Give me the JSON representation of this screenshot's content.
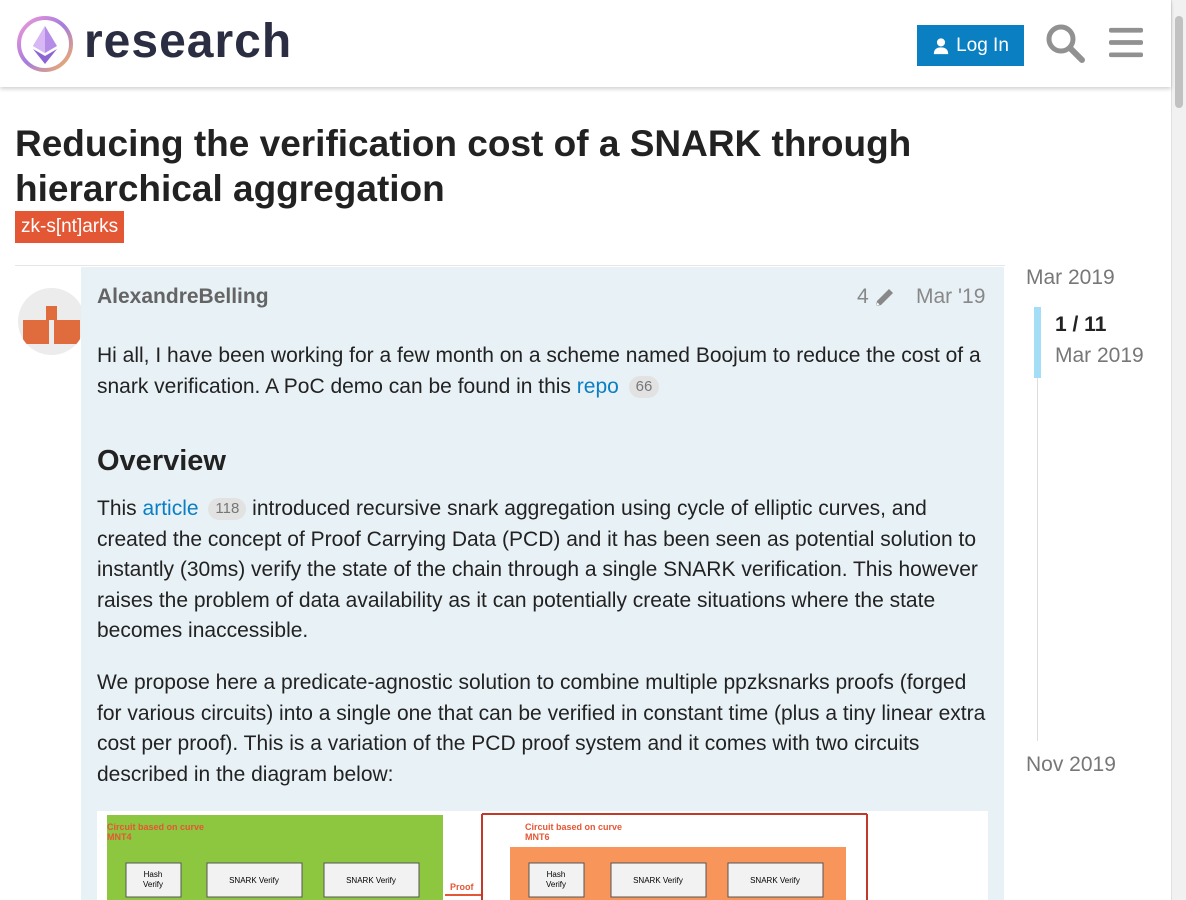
{
  "header": {
    "logo_text": "research",
    "login_label": "Log In",
    "search_icon": "search-icon",
    "menu_icon": "hamburger-menu-icon"
  },
  "topic": {
    "title": "Reducing the verification cost of a SNARK through hierarchical aggregation",
    "tag": "zk-s[nt]arks"
  },
  "post": {
    "author": "AlexandreBelling",
    "edit_count": "4",
    "date": "Mar '19",
    "p1_before": "Hi all, I have been working for a few month on a scheme named Boojum to reduce the cost of a snark verification. A PoC demo can be found in this ",
    "p1_link": "repo",
    "p1_link_clicks": "66",
    "heading": "Overview",
    "p2_before": "This ",
    "p2_link": "article",
    "p2_link_clicks": "118",
    "p2_after": " introduced recursive snark aggregation using cycle of elliptic curves, and created the concept of Proof Carrying Data (PCD) and it has been seen as potential solution to instantly (30ms) verify the state of the chain through a single SNARK verification. This however raises the problem of data availability as it can potentially create situations where the state becomes inaccessible.",
    "p3": "We propose here a predicate-agnostic solution to combine multiple ppzksnarks proofs (forged for various circuits) into a single one that can be verified in constant time (plus a tiny linear extra cost per proof). This is a variation of the PCD proof system and it comes with two circuits described in the diagram below:"
  },
  "diagram": {
    "left_title_1": "Circuit based on curve",
    "left_title_2": "MNT4",
    "right_title_1": "Circuit based on curve",
    "right_title_2": "MNT6",
    "hash_1": "Hash",
    "hash_2": "Verify",
    "snark": "SNARK Verify",
    "proof": "Proof",
    "left_color": "#8dc63f",
    "right_color": "#f7955b",
    "border_color": "#c0392b"
  },
  "timeline": {
    "start": "Mar 2019",
    "position": "1 / 11",
    "current": "Mar 2019",
    "end": "Nov 2019"
  },
  "colors": {
    "accent": "#0a7fc2",
    "tag_bg": "#e45735",
    "post_bg": "#e8f1f6",
    "avatar": "#e06c3d"
  }
}
